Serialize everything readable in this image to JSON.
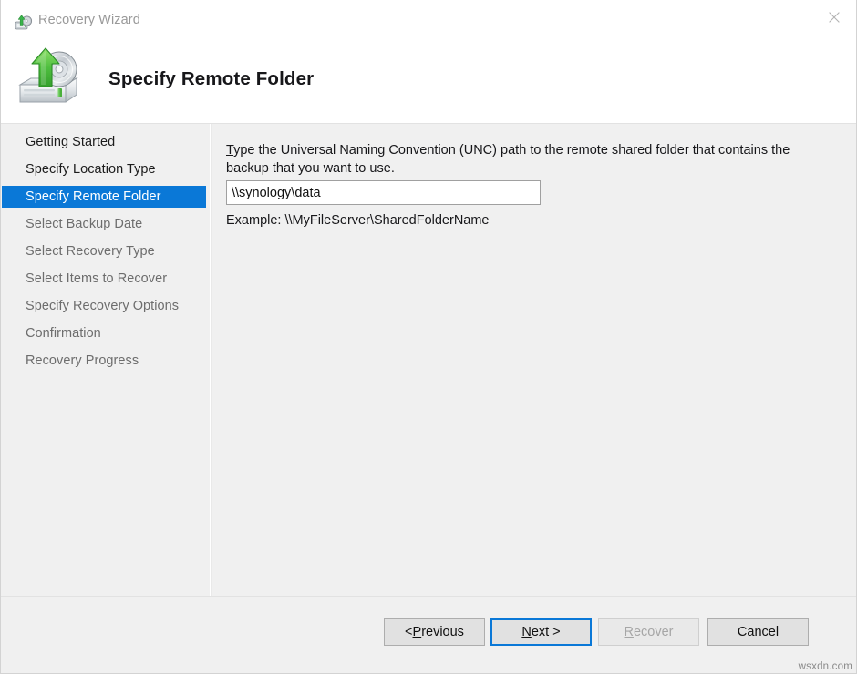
{
  "window": {
    "title": "Recovery Wizard",
    "title_icon": "recovery-wizard-icon",
    "close_icon": "close-icon"
  },
  "header": {
    "title": "Specify Remote Folder",
    "icon": "backup-drive-restore-icon"
  },
  "sidebar": {
    "items": [
      {
        "label": "Getting Started",
        "state": "done"
      },
      {
        "label": "Specify Location Type",
        "state": "done"
      },
      {
        "label": "Specify Remote Folder",
        "state": "current"
      },
      {
        "label": "Select Backup Date",
        "state": "todo"
      },
      {
        "label": "Select Recovery Type",
        "state": "todo"
      },
      {
        "label": "Select Items to Recover",
        "state": "todo"
      },
      {
        "label": "Specify Recovery Options",
        "state": "todo"
      },
      {
        "label": "Confirmation",
        "state": "todo"
      },
      {
        "label": "Recovery Progress",
        "state": "todo"
      }
    ]
  },
  "content": {
    "instruction_accel": "T",
    "instruction_rest": "ype the Universal Naming Convention (UNC) path to the remote shared folder that contains the backup that you want to use.",
    "unc_value": "\\\\synology\\data",
    "unc_placeholder": "",
    "example_text": "Example: \\\\MyFileServer\\SharedFolderName"
  },
  "footer": {
    "buttons": [
      {
        "prefix": "< ",
        "accel": "P",
        "suffix": "revious",
        "state": "normal",
        "name": "previous-button"
      },
      {
        "prefix": "",
        "accel": "N",
        "suffix": "ext >",
        "state": "focused",
        "name": "next-button"
      },
      {
        "prefix": "",
        "accel": "R",
        "suffix": "ecover",
        "state": "disabled",
        "name": "recover-button"
      },
      {
        "prefix": "",
        "accel": "",
        "suffix": "Cancel",
        "state": "normal",
        "name": "cancel-button"
      }
    ]
  },
  "watermark": "wsxdn.com",
  "colors": {
    "accent": "#0a78d7",
    "window_bg": "#f0f0f0",
    "header_bg": "#ffffff",
    "text": "#17171a",
    "text_muted": "#6d6d6d",
    "disabled": "#a6a6a6"
  }
}
